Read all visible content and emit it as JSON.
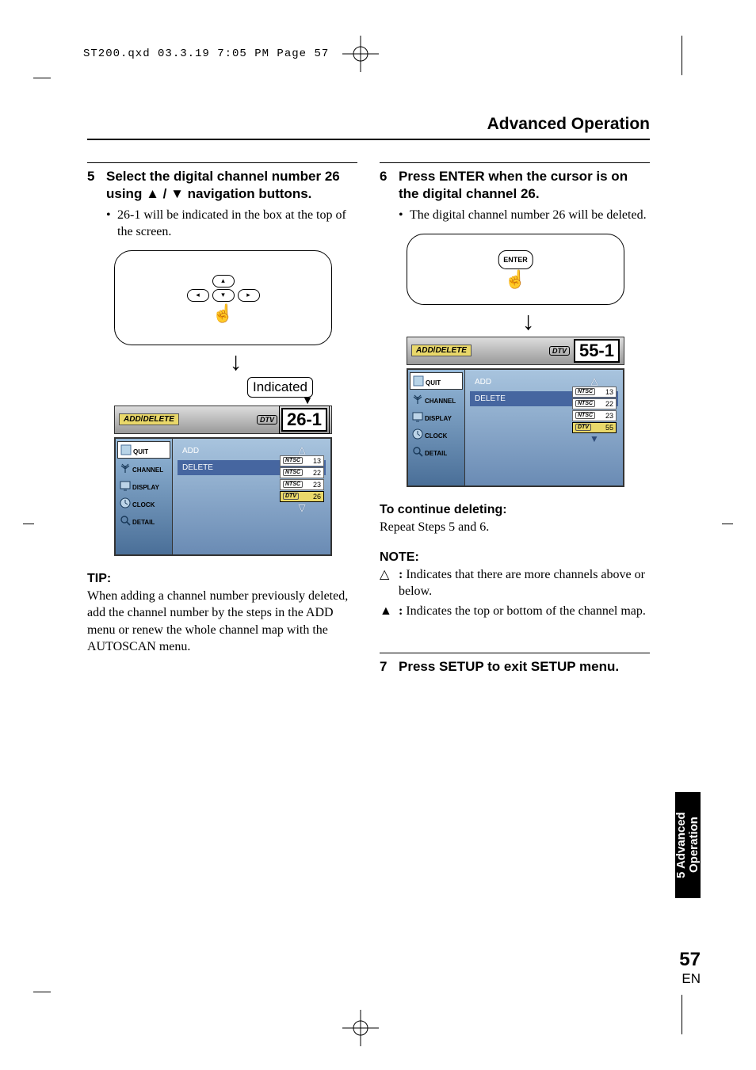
{
  "header": "ST200.qxd  03.3.19 7:05 PM  Page 57",
  "section_title": "Advanced Operation",
  "step5": {
    "num": "5",
    "title_a": "Select the digital channel number 26 using ",
    "title_b": " navigation buttons.",
    "bullet": "26-1 will be indicated in the box at the top of the screen.",
    "indicated": "Indicated",
    "channel_display": "26-1"
  },
  "step6": {
    "num": "6",
    "title": "Press ENTER when the cursor is on the digital channel 26.",
    "bullet": "The digital channel number 26 will be deleted.",
    "enter_label": "ENTER",
    "channel_display": "55-1"
  },
  "step7": {
    "num": "7",
    "title": "Press SETUP to exit SETUP menu."
  },
  "osd": {
    "bar_title": "ADD/DELETE",
    "dtv": "DTV",
    "sidebar": [
      "QUIT",
      "CHANNEL",
      "DISPLAY",
      "CLOCK",
      "DETAIL"
    ],
    "options": [
      "ADD",
      "DELETE"
    ],
    "channels_left": [
      {
        "tag": "NTSC",
        "num": "13"
      },
      {
        "tag": "NTSC",
        "num": "22"
      },
      {
        "tag": "NTSC",
        "num": "23"
      },
      {
        "tag": "DTV",
        "num": "26",
        "highlight": true
      }
    ],
    "channels_right": [
      {
        "tag": "NTSC",
        "num": "13"
      },
      {
        "tag": "NTSC",
        "num": "22"
      },
      {
        "tag": "NTSC",
        "num": "23"
      },
      {
        "tag": "DTV",
        "num": "55",
        "highlight": true
      }
    ]
  },
  "tip": {
    "heading": "TIP:",
    "body": "When adding a channel number previously deleted, add the channel number by the steps in the ADD menu or renew the whole channel map with the AUTOSCAN menu."
  },
  "continue": {
    "heading": "To continue deleting:",
    "body": "Repeat Steps 5 and 6."
  },
  "note": {
    "heading": "NOTE:",
    "item1": "Indicates that there are more channels above or below.",
    "item2": "Indicates the top or bottom of the channel map."
  },
  "side_tab": "5 Advanced Operation",
  "page_number": "57",
  "page_lang": "EN"
}
